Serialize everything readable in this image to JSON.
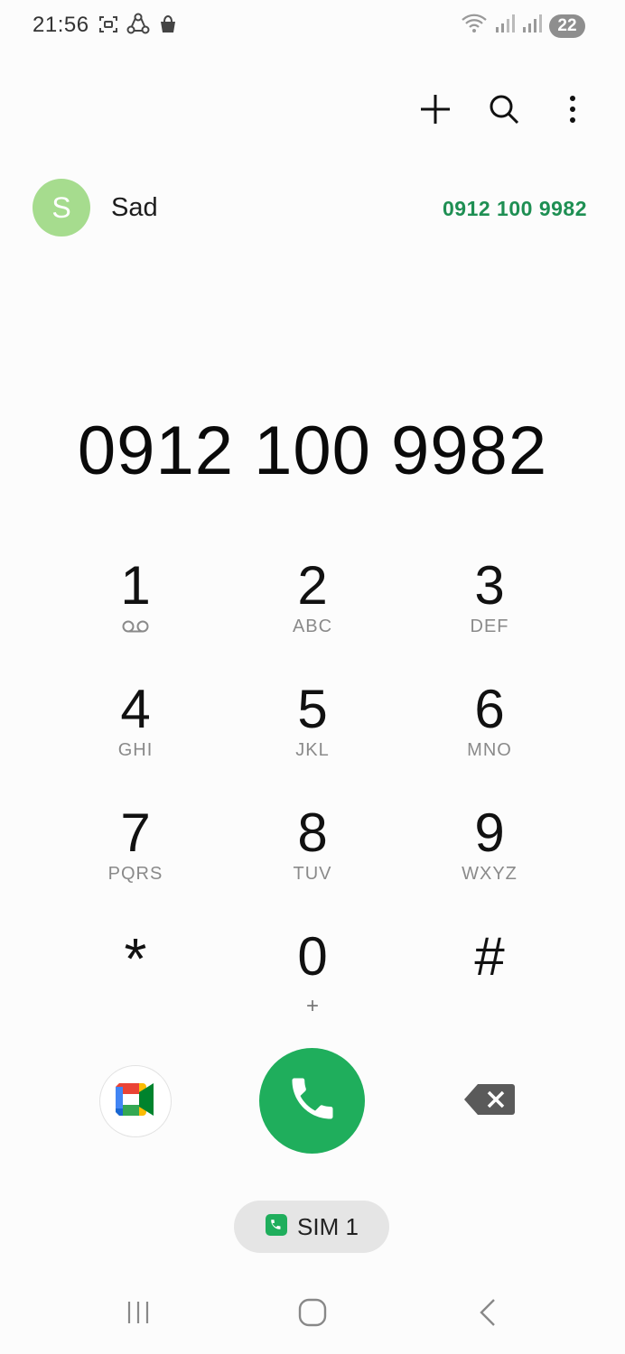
{
  "status_bar": {
    "time": "21:56",
    "battery_level": "22",
    "left_icons": [
      "screenshot-icon",
      "sync-icon",
      "shopping-bag-icon"
    ],
    "right_icons": [
      "wifi-icon",
      "signal-icon",
      "signal-icon"
    ]
  },
  "toolbar": {
    "add_icon": "plus-icon",
    "search_icon": "search-icon",
    "more_icon": "more-vertical-icon"
  },
  "suggestion": {
    "avatar_letter": "S",
    "name": "Sad",
    "number": "0912 100 9982",
    "avatar_color": "#a6dc8e",
    "number_color": "#1e8f53"
  },
  "dialed_number": "0912 100 9982",
  "keypad": {
    "keys": [
      {
        "digit": "1",
        "letters": ""
      },
      {
        "digit": "2",
        "letters": "ABC"
      },
      {
        "digit": "3",
        "letters": "DEF"
      },
      {
        "digit": "4",
        "letters": "GHI"
      },
      {
        "digit": "5",
        "letters": "JKL"
      },
      {
        "digit": "6",
        "letters": "MNO"
      },
      {
        "digit": "7",
        "letters": "PQRS"
      },
      {
        "digit": "8",
        "letters": "TUV"
      },
      {
        "digit": "9",
        "letters": "WXYZ"
      },
      {
        "digit": "*",
        "letters": ""
      },
      {
        "digit": "0",
        "letters": "+"
      },
      {
        "digit": "#",
        "letters": ""
      }
    ],
    "voicemail_icon": "voicemail-icon"
  },
  "actions": {
    "video_icon": "google-meet-icon",
    "call_icon": "phone-icon",
    "backspace_icon": "backspace-icon",
    "call_color": "#1fae5c"
  },
  "sim": {
    "label": "SIM 1",
    "icon": "sim-phone-icon"
  },
  "nav": {
    "recents_icon": "recents-icon",
    "home_icon": "home-icon",
    "back_icon": "back-icon"
  }
}
